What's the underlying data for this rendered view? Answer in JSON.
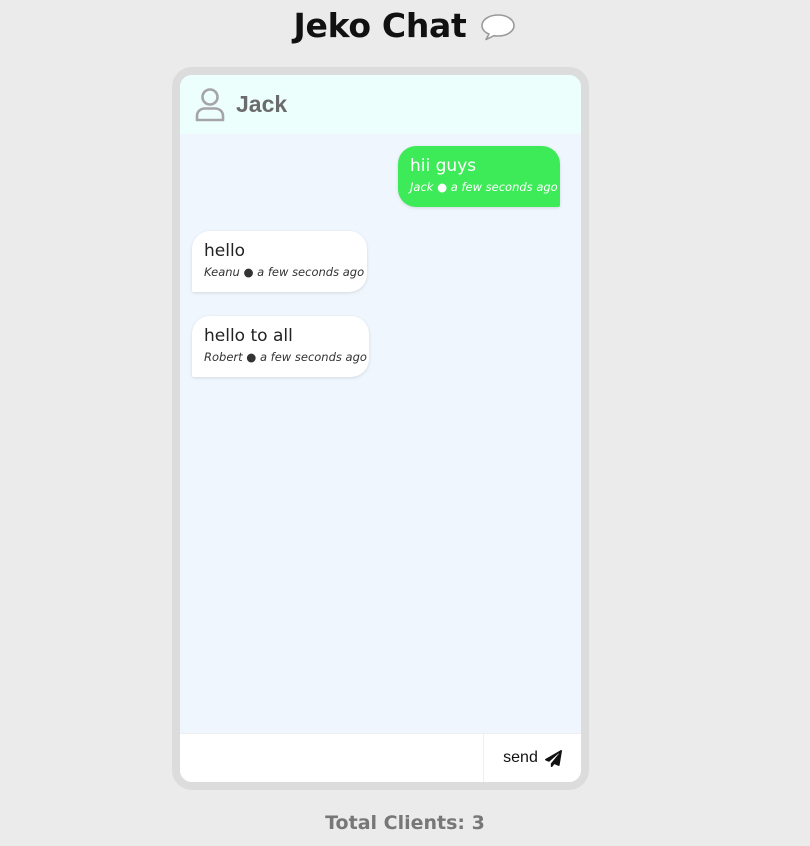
{
  "app": {
    "title": "Jeko Chat",
    "title_icon": "speech-bubble-icon"
  },
  "chat": {
    "user_name": "Jack",
    "user_icon": "user-icon",
    "messages": [
      {
        "text": "hii guys",
        "author": "Jack",
        "time": "a few seconds ago",
        "meta": "Jack ● a few seconds ago",
        "mine": true
      },
      {
        "text": "hello",
        "author": "Keanu",
        "time": "a few seconds ago",
        "meta": "Keanu ● a few seconds ago",
        "mine": false
      },
      {
        "text": "hello to all",
        "author": "Robert",
        "time": "a few seconds ago",
        "meta": "Robert ● a few seconds ago",
        "mine": false
      }
    ]
  },
  "composer": {
    "message_value": "",
    "send_label": "send",
    "send_icon": "paper-plane-icon"
  },
  "footer": {
    "total_clients": "Total Clients: 3"
  },
  "colors": {
    "page_background": "#ebebeb",
    "own_message": "#3dea57",
    "other_message": "#ffffff",
    "chat_background": "#eff6fd",
    "header_background": "#ecfffd"
  }
}
